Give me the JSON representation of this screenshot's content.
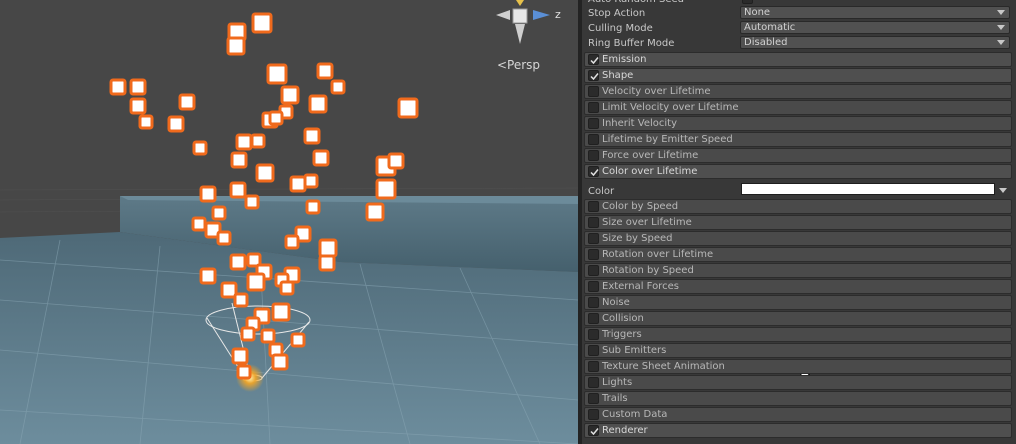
{
  "scene": {
    "projection_label": "<Persp",
    "gizmo_axis_label": "z"
  },
  "inspector": {
    "properties": [
      {
        "label": "Auto Random Seed",
        "value": "✓"
      },
      {
        "label": "Stop Action",
        "value": "None"
      },
      {
        "label": "Culling Mode",
        "value": "Automatic"
      },
      {
        "label": "Ring Buffer Mode",
        "value": "Disabled"
      }
    ],
    "modules_top": [
      {
        "label": "Emission",
        "enabled": true
      },
      {
        "label": "Shape",
        "enabled": true
      },
      {
        "label": "Velocity over Lifetime",
        "enabled": false
      },
      {
        "label": "Limit Velocity over Lifetime",
        "enabled": false
      },
      {
        "label": "Inherit Velocity",
        "enabled": false
      },
      {
        "label": "Lifetime by Emitter Speed",
        "enabled": false
      },
      {
        "label": "Force over Lifetime",
        "enabled": false
      },
      {
        "label": "Color over Lifetime",
        "enabled": true
      }
    ],
    "color_field": {
      "label": "Color",
      "value_hex": "#ffffff"
    },
    "modules_bottom": [
      {
        "label": "Color by Speed",
        "enabled": false
      },
      {
        "label": "Size over Lifetime",
        "enabled": false
      },
      {
        "label": "Size by Speed",
        "enabled": false
      },
      {
        "label": "Rotation over Lifetime",
        "enabled": false
      },
      {
        "label": "Rotation by Speed",
        "enabled": false
      },
      {
        "label": "External Forces",
        "enabled": false
      },
      {
        "label": "Noise",
        "enabled": false
      },
      {
        "label": "Collision",
        "enabled": false
      },
      {
        "label": "Triggers",
        "enabled": false
      },
      {
        "label": "Sub Emitters",
        "enabled": false
      },
      {
        "label": "Texture Sheet Animation",
        "enabled": false
      },
      {
        "label": "Lights",
        "enabled": false
      },
      {
        "label": "Trails",
        "enabled": false
      },
      {
        "label": "Custom Data",
        "enabled": false
      },
      {
        "label": "Renderer",
        "enabled": true
      }
    ]
  },
  "colors": {
    "particle_fill": "#ffffff",
    "particle_outline": "#f06a1c",
    "floor": "#5a7888",
    "wall": "#4f6a78",
    "sky": "#474747"
  },
  "icons": {
    "gizmo": "scene-orientation-gizmo",
    "checkbox": "checkmark-icon",
    "dropdown": "dropdown-arrow-icon",
    "cursor": "mouse-pointer-icon"
  }
}
